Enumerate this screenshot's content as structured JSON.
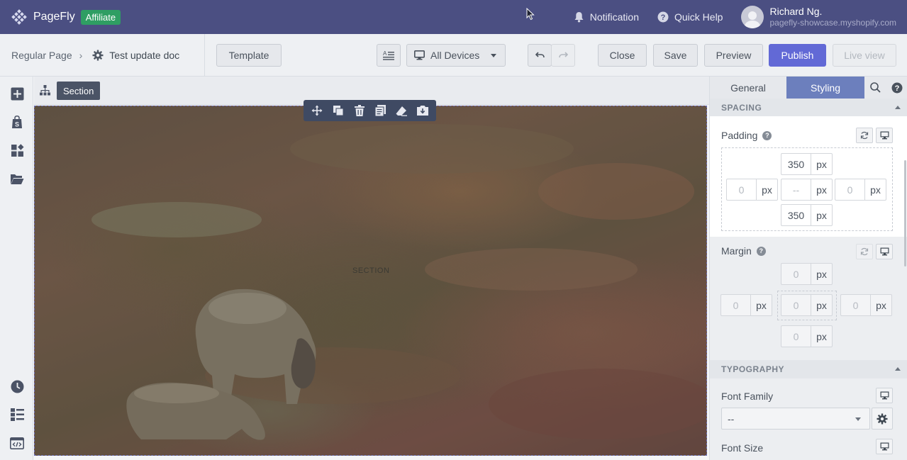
{
  "header": {
    "brand": "PageFly",
    "badge": "Affiliate",
    "notification_label": "Notification",
    "help_label": "Quick Help",
    "user_name": "Richard Ng.",
    "user_store": "pagefly-showcase.myshopify.com"
  },
  "toolbar": {
    "breadcrumb_root": "Regular Page",
    "breadcrumb_sep": "›",
    "page_name": "Test update doc",
    "template_label": "Template",
    "device_label": "All Devices",
    "close_label": "Close",
    "save_label": "Save",
    "preview_label": "Preview",
    "publish_label": "Publish",
    "live_view_label": "Live view"
  },
  "canvas": {
    "selected_chip": "Section",
    "section_label": "SECTION"
  },
  "panel": {
    "tabs": [
      {
        "label": "General",
        "active": false
      },
      {
        "label": "Styling",
        "active": true
      }
    ],
    "spacing_heading": "SPACING",
    "padding": {
      "label": "Padding",
      "top": "350",
      "right": "",
      "bottom": "350",
      "left": "",
      "center_placeholder": "--",
      "side_placeholder": "0",
      "unit": "px"
    },
    "margin": {
      "label": "Margin",
      "placeholder": "0",
      "unit": "px"
    },
    "typography_heading": "TYPOGRAPHY",
    "font_family_label": "Font Family",
    "font_family_value": "--",
    "font_size_label": "Font Size"
  },
  "colors": {
    "topbar": "#4b4f82",
    "badge": "#2f9e63",
    "primary": "#6269d6",
    "active_tab": "#6c7fbd"
  }
}
